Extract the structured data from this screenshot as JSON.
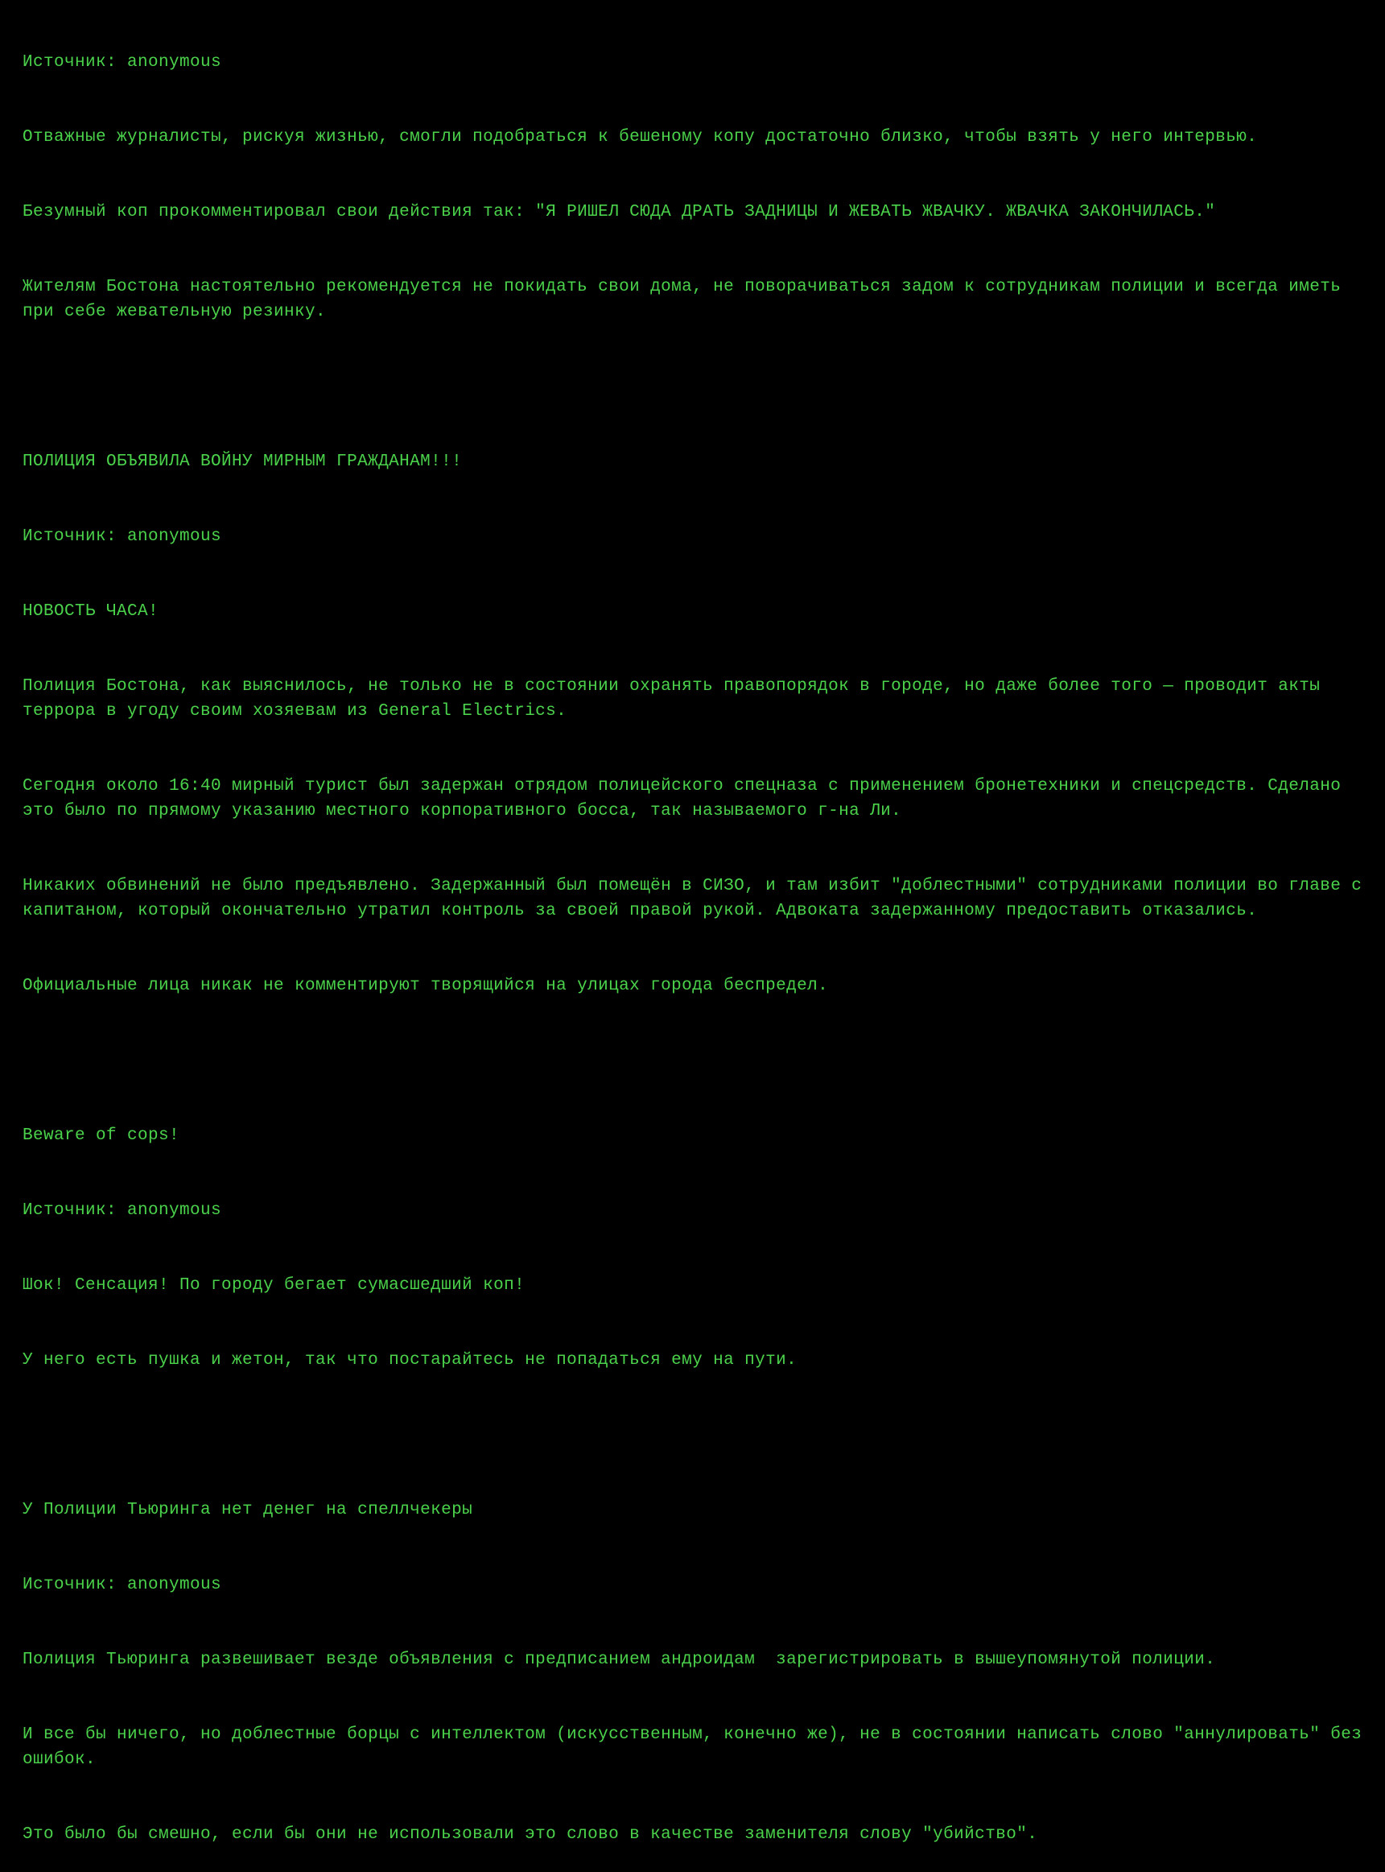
{
  "lines": [
    "Источник: anonymous",
    "Отважные журналисты, рискуя жизнью, смогли подобраться к бешеному копу достаточно близко, чтобы взять у него интервью.",
    "Безумный коп прокомментировал свои действия так: \"Я РИШЕЛ СЮДА ДРАТЬ ЗАДНИЦЫ И ЖЕВАТЬ ЖВАЧКУ. ЖВАЧКА ЗАКОНЧИЛАСЬ.\"",
    "Жителям Бостона настоятельно рекомендуется не покидать свои дома, не поворачиваться задом к сотрудникам полиции и всегда иметь при себе жевательную резинку.",
    "",
    "ПОЛИЦИЯ ОБЪЯВИЛА ВОЙНУ МИРНЫМ ГРАЖДАНАМ!!!",
    "Источник: anonymous",
    "НОВОСТЬ ЧАСА!",
    "Полиция Бостона, как выяснилось, не только не в состоянии охранять правопорядок в городе, но даже более того — проводит акты террора в угоду своим хозяевам из General Electrics.",
    "Сегодня около 16:40 мирный турист был задержан отрядом полицейского спецназа с применением бронетехники и спецсредств. Сделано это было по прямому указанию местного корпоративного босса, так называемого г-на Ли.",
    "Никаких обвинений не было предъявлено. Задержанный был помещён в СИЗО, и там избит \"доблестными\" сотрудниками полиции во главе с капитаном, который окончательно утратил контроль за своей правой рукой. Адвоката задержанному предоставить отказались.",
    "Официальные лица никак не комментируют творящийся на улицах города беспредел.",
    "",
    "Beware of cops!",
    "Источник: anonymous",
    "Шок! Сенсация! По городу бегает сумасшедший коп!",
    "У него есть пушка и жетон, так что постарайтесь не попадаться ему на пути.",
    "",
    "У Полиции Тьюринга нет денег на спеллчекеры",
    "Источник: anonymous",
    "Полиция Тьюринга развешивает везде объявления с предписанием андроидам  зарегистрировать в вышеупомянутой полиции.",
    "И все бы ничего, но доблестные борцы с интеллектом (искусственным, конечно же), не в состоянии написать слово \"аннулировать\" без ошибок.",
    "Это было бы смешно, если бы они не использовали это слово в качестве заменителя слову \"убийство\"."
  ]
}
